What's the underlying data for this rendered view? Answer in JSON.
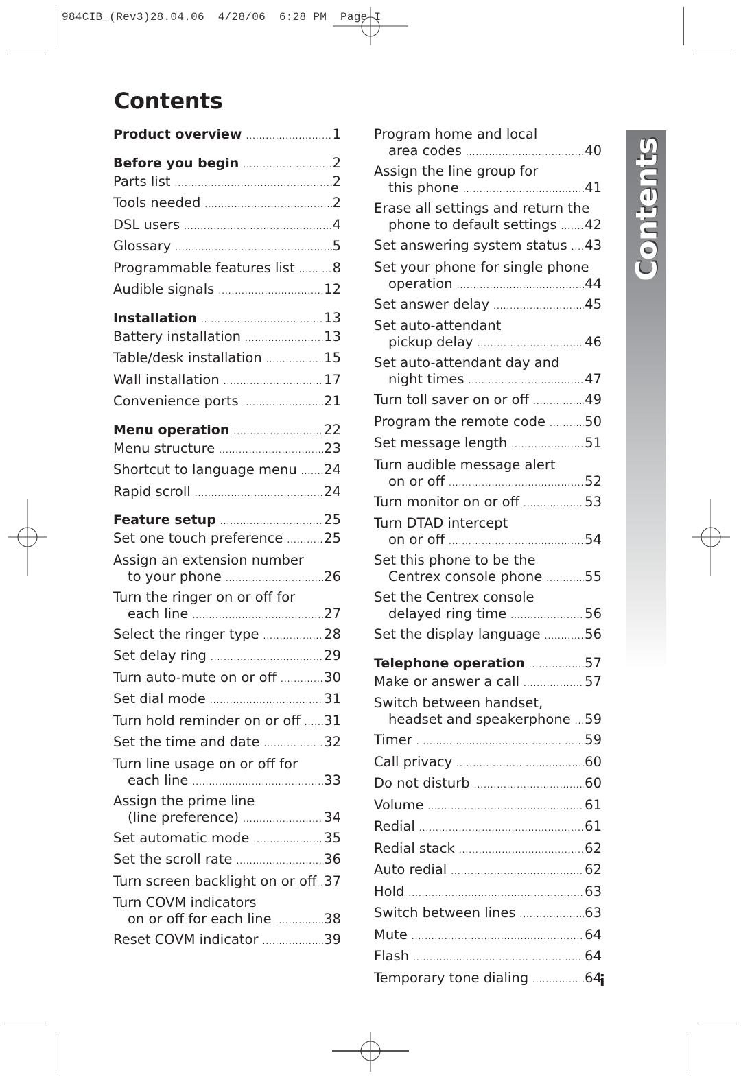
{
  "slug_line": "984CIB_(Rev3)28.04.06  4/28/06  6:28 PM  Page I",
  "title": "Contents",
  "side_tab_label": "Contents",
  "folio": "i",
  "left_column": [
    {
      "lines": [
        "Product overview"
      ],
      "page": "1",
      "bold": true
    },
    {
      "lines": [
        "Before you begin"
      ],
      "page": "2",
      "bold": true,
      "section": true
    },
    {
      "lines": [
        "Parts list"
      ],
      "page": "2"
    },
    {
      "lines": [
        "Tools needed"
      ],
      "page": "2"
    },
    {
      "lines": [
        "DSL users"
      ],
      "page": "4"
    },
    {
      "lines": [
        "Glossary"
      ],
      "page": "5"
    },
    {
      "lines": [
        "Programmable features list"
      ],
      "page": "8"
    },
    {
      "lines": [
        "Audible signals"
      ],
      "page": "12"
    },
    {
      "lines": [
        "Installation"
      ],
      "page": "13",
      "bold": true,
      "section": true
    },
    {
      "lines": [
        "Battery installation"
      ],
      "page": "13"
    },
    {
      "lines": [
        "Table/desk installation"
      ],
      "page": "15"
    },
    {
      "lines": [
        "Wall installation"
      ],
      "page": "17"
    },
    {
      "lines": [
        "Convenience ports"
      ],
      "page": "21"
    },
    {
      "lines": [
        "Menu operation"
      ],
      "page": "22",
      "bold": true,
      "section": true
    },
    {
      "lines": [
        "Menu structure"
      ],
      "page": "23"
    },
    {
      "lines": [
        "Shortcut to language menu"
      ],
      "page": "24"
    },
    {
      "lines": [
        "Rapid scroll"
      ],
      "page": "24"
    },
    {
      "lines": [
        "Feature setup"
      ],
      "page": "25",
      "bold": true,
      "section": true
    },
    {
      "lines": [
        "Set one touch preference"
      ],
      "page": "25"
    },
    {
      "lines": [
        "Assign an extension number",
        "to your phone"
      ],
      "page": "26"
    },
    {
      "lines": [
        "Turn the ringer on or off for",
        "each line"
      ],
      "page": "27"
    },
    {
      "lines": [
        "Select the ringer type"
      ],
      "page": "28"
    },
    {
      "lines": [
        "Set delay ring"
      ],
      "page": "29"
    },
    {
      "lines": [
        "Turn auto-mute on or off"
      ],
      "page": "30"
    },
    {
      "lines": [
        "Set dial mode"
      ],
      "page": "31"
    },
    {
      "lines": [
        "Turn hold reminder on or off"
      ],
      "page": "31"
    },
    {
      "lines": [
        "Set the time and date"
      ],
      "page": "32"
    },
    {
      "lines": [
        "Turn line usage on or off for",
        "each line"
      ],
      "page": "33"
    },
    {
      "lines": [
        "Assign the prime line",
        "(line preference)"
      ],
      "page": "34"
    },
    {
      "lines": [
        "Set automatic mode"
      ],
      "page": "35"
    },
    {
      "lines": [
        "Set the scroll rate"
      ],
      "page": "36"
    },
    {
      "lines": [
        "Turn screen backlight on or off"
      ],
      "page": "37"
    },
    {
      "lines": [
        "Turn COVM indicators",
        "on or off for each line"
      ],
      "page": "38"
    },
    {
      "lines": [
        "Reset COVM indicator"
      ],
      "page": "39"
    }
  ],
  "right_column": [
    {
      "lines": [
        "Program home and local",
        "area codes"
      ],
      "page": "40"
    },
    {
      "lines": [
        "Assign the line group for",
        "this phone"
      ],
      "page": "41"
    },
    {
      "lines": [
        "Erase all settings and return the",
        "phone to default settings"
      ],
      "page": "42"
    },
    {
      "lines": [
        "Set answering system status"
      ],
      "page": "43"
    },
    {
      "lines": [
        "Set your phone for single phone",
        "operation"
      ],
      "page": "44"
    },
    {
      "lines": [
        "Set answer delay"
      ],
      "page": "45"
    },
    {
      "lines": [
        "Set auto-attendant",
        "pickup delay"
      ],
      "page": "46"
    },
    {
      "lines": [
        "Set auto-attendant day and",
        "night times"
      ],
      "page": "47"
    },
    {
      "lines": [
        "Turn toll saver on or off"
      ],
      "page": "49"
    },
    {
      "lines": [
        "Program the remote code"
      ],
      "page": "50"
    },
    {
      "lines": [
        "Set message length"
      ],
      "page": "51"
    },
    {
      "lines": [
        "Turn audible message alert",
        "on or off"
      ],
      "page": "52"
    },
    {
      "lines": [
        "Turn monitor on or off"
      ],
      "page": "53"
    },
    {
      "lines": [
        "Turn DTAD intercept",
        "on or off"
      ],
      "page": "54"
    },
    {
      "lines": [
        "Set this phone to be the",
        "Centrex console phone"
      ],
      "page": "55"
    },
    {
      "lines": [
        "Set the Centrex console",
        "delayed ring time"
      ],
      "page": "56"
    },
    {
      "lines": [
        "Set the display language"
      ],
      "page": "56"
    },
    {
      "lines": [
        "Telephone operation"
      ],
      "page": "57",
      "bold": true,
      "section": true
    },
    {
      "lines": [
        "Make or answer a call"
      ],
      "page": "57"
    },
    {
      "lines": [
        "Switch between handset,",
        "headset and speakerphone"
      ],
      "page": "59"
    },
    {
      "lines": [
        "Timer"
      ],
      "page": "59"
    },
    {
      "lines": [
        "Call privacy"
      ],
      "page": "60"
    },
    {
      "lines": [
        "Do not disturb"
      ],
      "page": "60"
    },
    {
      "lines": [
        "Volume"
      ],
      "page": "61"
    },
    {
      "lines": [
        "Redial"
      ],
      "page": "61"
    },
    {
      "lines": [
        "Redial stack"
      ],
      "page": "62"
    },
    {
      "lines": [
        "Auto redial"
      ],
      "page": "62"
    },
    {
      "lines": [
        "Hold"
      ],
      "page": "63"
    },
    {
      "lines": [
        "Switch between lines"
      ],
      "page": "63"
    },
    {
      "lines": [
        "Mute"
      ],
      "page": "64"
    },
    {
      "lines": [
        "Flash"
      ],
      "page": "64"
    },
    {
      "lines": [
        "Temporary tone dialing"
      ],
      "page": "64"
    }
  ]
}
